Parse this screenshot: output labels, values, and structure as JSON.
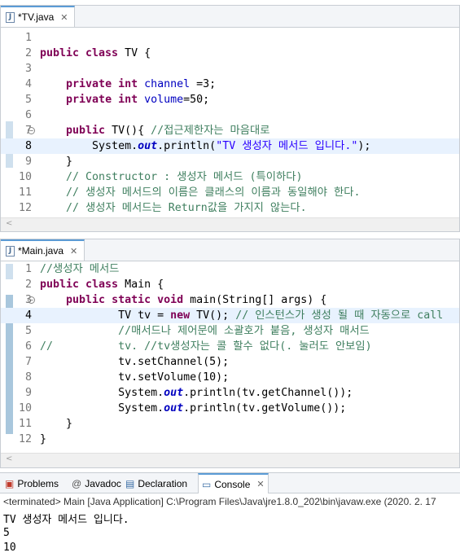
{
  "tv_editor": {
    "tab_label": "*TV.java",
    "lines": [
      {
        "n": "1",
        "html": ""
      },
      {
        "n": "2",
        "html": "<span class='kw'>public class</span> TV {"
      },
      {
        "n": "3",
        "html": ""
      },
      {
        "n": "4",
        "html": "    <span class='kw'>private int</span> <span class='fld'>channel</span> =3;"
      },
      {
        "n": "5",
        "html": "    <span class='kw'>private int</span> <span class='fld'>volume</span>=50;"
      },
      {
        "n": "6",
        "html": ""
      },
      {
        "n": "7",
        "html": "    <span class='kw'>public</span> TV(){ <span class='cmt'>//접근제한자는 마음대로</span>"
      },
      {
        "n": "8",
        "html": "        System.<span class='sfld'>out</span>.println(<span class='str'>\"TV 생성자 메서드 입니다.\"</span>);"
      },
      {
        "n": "9",
        "html": "    }"
      },
      {
        "n": "10",
        "html": "    <span class='cmt'>// Constructor : 생성자 메서드 (특이하다)</span>"
      },
      {
        "n": "11",
        "html": "    <span class='cmt'>// 생성자 메서드의 이름은 클래스의 이름과 동일해야 한다.</span>"
      },
      {
        "n": "12",
        "html": "    <span class='cmt'>// 생성자 메서드는 Return값을 가지지 않는다.</span>"
      }
    ]
  },
  "main_editor": {
    "tab_label": "*Main.java",
    "lines": [
      {
        "n": "1",
        "html": "<span class='cmt'>//생성자 메서드</span>"
      },
      {
        "n": "2",
        "html": "<span class='kw'>public class</span> Main {"
      },
      {
        "n": "3",
        "html": "    <span class='kw'>public static void</span> main(String[] args) {"
      },
      {
        "n": "4",
        "html": "            TV tv = <span class='kw'>new</span> TV(); <span class='cmt'>// 인스턴스가 생성 될 때 자동으로 call</span>"
      },
      {
        "n": "5",
        "html": "            <span class='cmt'>//매서드나 제어문에 소괄호가 붙음, 생성자 매서드</span>"
      },
      {
        "n": "6",
        "html": "<span class='cmt'>//          tv. //tv생성자는 콜 할수 없다(. 눌러도 안보임)</span>"
      },
      {
        "n": "7",
        "html": "            tv.setChannel(5);"
      },
      {
        "n": "8",
        "html": "            tv.setVolume(10);"
      },
      {
        "n": "9",
        "html": "            System.<span class='sfld'>out</span>.println(tv.getChannel());"
      },
      {
        "n": "10",
        "html": "            System.<span class='sfld'>out</span>.println(tv.getVolume());"
      },
      {
        "n": "11",
        "html": "    }"
      },
      {
        "n": "12",
        "html": "}"
      }
    ]
  },
  "console": {
    "tabs": [
      {
        "label": "Problems",
        "icon": "problems-icon"
      },
      {
        "label": "Javadoc",
        "icon": "javadoc-icon"
      },
      {
        "label": "Declaration",
        "icon": "declaration-icon"
      },
      {
        "label": "Console",
        "icon": "console-icon"
      }
    ],
    "status": "<terminated> Main [Java Application] C:\\Program Files\\Java\\jre1.8.0_202\\bin\\javaw.exe (2020. 2. 17",
    "output": [
      "TV 생성자 메서드 입니다.",
      "5",
      "10"
    ]
  }
}
